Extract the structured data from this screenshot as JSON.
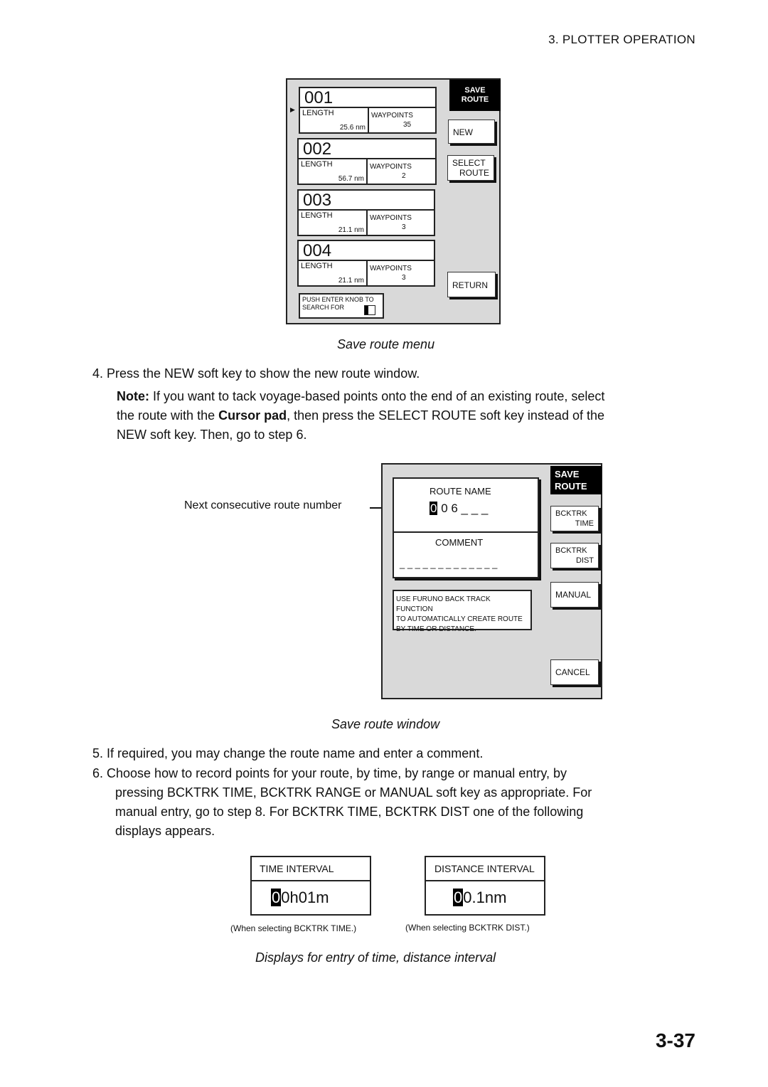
{
  "header": "3.  PLOTTER  OPERATION",
  "fig1": {
    "title": [
      "SAVE",
      "ROUTE"
    ],
    "routes": [
      {
        "name": "001",
        "length_label": "LENGTH",
        "length": "25.6 nm",
        "waypoints_label": "WAYPOINTS",
        "waypoints": "35",
        "selected": true
      },
      {
        "name": "002",
        "length_label": "LENGTH",
        "length": "56.7 nm",
        "waypoints_label": "WAYPOINTS",
        "waypoints": "2",
        "selected": false
      },
      {
        "name": "003",
        "length_label": "LENGTH",
        "length": "21.1 nm",
        "waypoints_label": "WAYPOINTS",
        "waypoints": "3",
        "selected": false
      },
      {
        "name": "004",
        "length_label": "LENGTH",
        "length": "21.1 nm",
        "waypoints_label": "WAYPOINTS",
        "waypoints": "3",
        "selected": false
      }
    ],
    "softkeys": {
      "new": "NEW",
      "select_route_1": "SELECT",
      "select_route_2": "ROUTE",
      "return": "RETURN"
    },
    "search_hint": [
      "PUSH ENTER KNOB TO",
      "SEARCH FOR"
    ],
    "caption": "Save route menu"
  },
  "step4": "4.  Press the NEW soft key to show the new route window.",
  "note": {
    "label": "Note:",
    "text1": " If you want to tack voyage-based points onto the end of an existing route, select",
    "text2a": "the route with the ",
    "bold": "Cursor pad",
    "text2b": ", then press the SELECT ROUTE soft key instead of the",
    "text3": "NEW soft key. Then, go to step 6."
  },
  "fig2": {
    "title": [
      "SAVE",
      "ROUTE"
    ],
    "callout": "Next consecutive route number",
    "route_name_label": "ROUTE NAME",
    "route_name_cursor": "0",
    "route_name_rest": " 0 6 _ _ _",
    "comment_label": "COMMENT",
    "comment_value": "_ _ _ _ _ _ _ _ _ _ _ _ _",
    "info": [
      "USE FURUNO BACK TRACK FUNCTION",
      "TO AUTOMATICALLY CREATE ROUTE",
      "BY TIME OR DISTANCE."
    ],
    "softkeys": {
      "bcktrk_time_1": "BCKTRK",
      "bcktrk_time_2": "TIME",
      "bcktrk_dist_1": "BCKTRK",
      "bcktrk_dist_2": "DIST",
      "manual": "MANUAL",
      "cancel": "CANCEL"
    },
    "caption": "Save route window"
  },
  "step5": "5.  If required, you may change the route name and enter a comment.",
  "step6": [
    "6.  Choose how to record points for your route, by time, by range or manual entry, by",
    "pressing BCKTRK TIME, BCKTRK RANGE or MANUAL soft key as appropriate. For",
    "manual entry, go to step 8. For BCKTRK TIME, BCKTRK DIST one of the following",
    "displays appears."
  ],
  "fig3": {
    "time": {
      "label": "TIME INTERVAL",
      "cursor": "0",
      "value": "0h01m",
      "note": "(When selecting BCKTRK TIME.)"
    },
    "dist": {
      "label": "DISTANCE INTERVAL",
      "cursor": "0",
      "value": "0.1nm",
      "note": "(When selecting BCKTRK DIST.)"
    },
    "caption": "Displays for entry of time, distance interval"
  },
  "page_number": "3-37"
}
